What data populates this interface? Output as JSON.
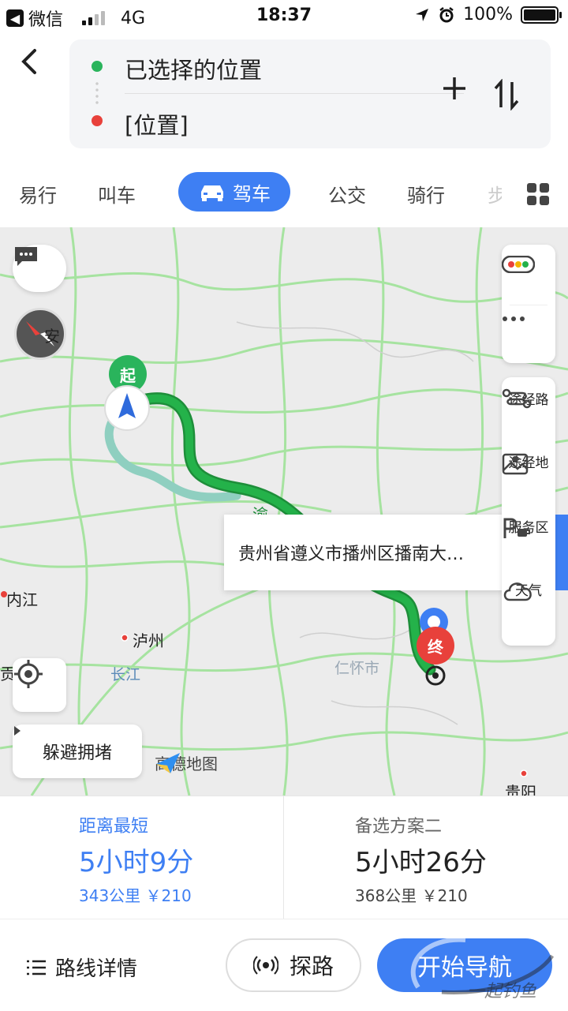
{
  "status_bar": {
    "carrier": "微信",
    "network": "4G",
    "time": "18:37",
    "battery": "100%"
  },
  "route": {
    "from": "已选择的位置",
    "to": "[位置]"
  },
  "tabs": [
    {
      "label": "易行"
    },
    {
      "label": "叫车"
    },
    {
      "label": "驾车",
      "active": true
    },
    {
      "label": "公交"
    },
    {
      "label": "骑行"
    },
    {
      "label": "步"
    }
  ],
  "map": {
    "start_pin": "起",
    "end_pin": "终",
    "popup_address": "贵州省遵义市播州区播南大…",
    "avoid_button": "躲避拥堵",
    "logo_text": "高德地图",
    "labels": {
      "neijiang": "内江",
      "luzhou": "泸州",
      "changjiang": "长江",
      "renhuai": "仁怀市",
      "guiyang": "贵阳",
      "guangan_fragment": "安",
      "gong_fragment": "贡",
      "road_fragment": "渝"
    },
    "tools": {
      "waypoint_route": "途经路",
      "waypoint_place": "途经地",
      "service_area": "服务区",
      "weather": "天气"
    },
    "colors": {
      "route_main": "#24b24a",
      "route_alt": "#8fcfc0",
      "road": "#a6e3a0"
    }
  },
  "plans": [
    {
      "title": "距离最短",
      "time": "5小时9分",
      "meta": "343公里 ￥210",
      "selected": true
    },
    {
      "title": "备选方案二",
      "time": "5小时26分",
      "meta": "368公里 ￥210",
      "selected": false
    }
  ],
  "bottom_bar": {
    "detail": "路线详情",
    "explore": "探路",
    "start_nav": "开始导航"
  },
  "watermark": "一起钓鱼"
}
